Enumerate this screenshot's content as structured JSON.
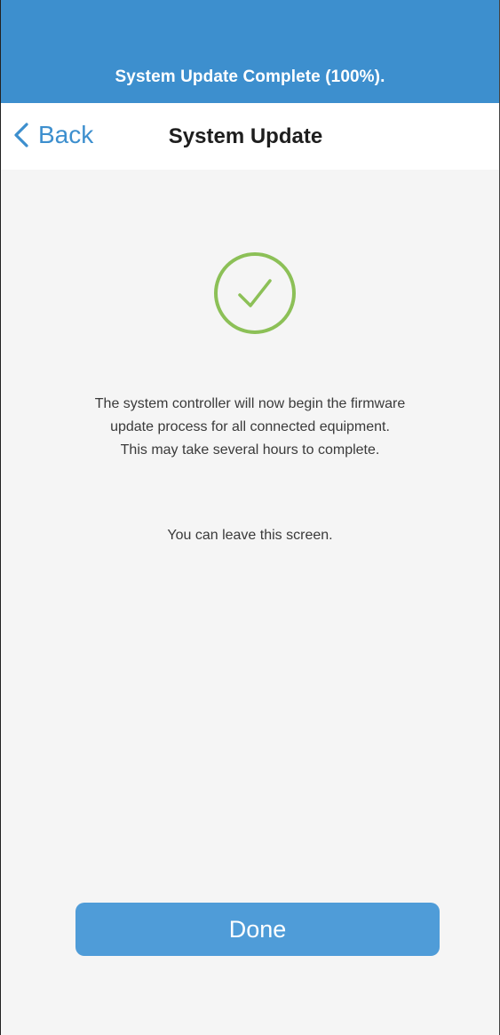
{
  "status_banner": {
    "text": "System Update Complete (100%)."
  },
  "nav": {
    "back_label": "Back",
    "title": "System Update"
  },
  "content": {
    "icon": "check-circle-icon",
    "message_lines": [
      "The system controller will now begin the firmware",
      "update process for all connected equipment.",
      "This may take several hours to complete."
    ],
    "leave_note": "You can leave this screen."
  },
  "actions": {
    "done_label": "Done"
  },
  "colors": {
    "banner": "#3d8fce",
    "accent": "#3d8fce",
    "success": "#8cc057",
    "button": "#4f9cd8",
    "background": "#f5f5f5"
  }
}
